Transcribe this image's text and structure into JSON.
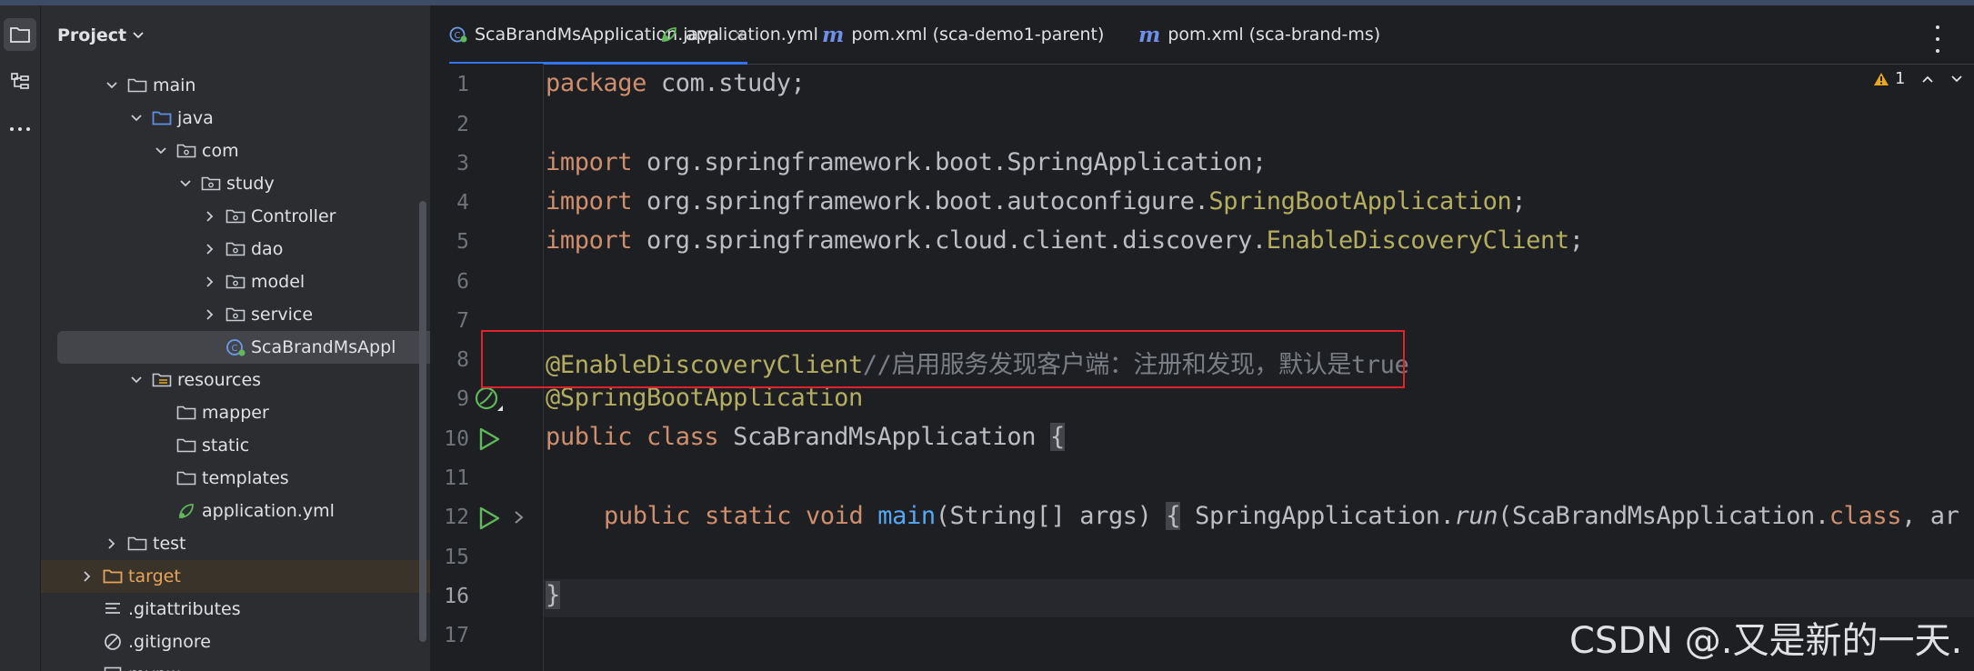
{
  "project_panel": {
    "title": "Project",
    "tree": [
      {
        "label": "main",
        "type": "folder",
        "depth": 3,
        "expanded": true
      },
      {
        "label": "java",
        "type": "source-folder",
        "depth": 4,
        "expanded": true
      },
      {
        "label": "com",
        "type": "package",
        "depth": 5,
        "expanded": true
      },
      {
        "label": "study",
        "type": "package",
        "depth": 6,
        "expanded": true
      },
      {
        "label": "Controller",
        "type": "package",
        "depth": 7,
        "expanded": false
      },
      {
        "label": "dao",
        "type": "package",
        "depth": 7,
        "expanded": false
      },
      {
        "label": "model",
        "type": "package",
        "depth": 7,
        "expanded": false
      },
      {
        "label": "service",
        "type": "package",
        "depth": 7,
        "expanded": false
      },
      {
        "label": "ScaBrandMsAppl",
        "type": "spring-class",
        "depth": 7,
        "selected": true
      },
      {
        "label": "resources",
        "type": "resources-folder",
        "depth": 4,
        "expanded": true
      },
      {
        "label": "mapper",
        "type": "folder",
        "depth": 5
      },
      {
        "label": "static",
        "type": "folder",
        "depth": 5
      },
      {
        "label": "templates",
        "type": "folder",
        "depth": 5
      },
      {
        "label": "application.yml",
        "type": "yml",
        "depth": 5
      },
      {
        "label": "test",
        "type": "folder",
        "depth": 3,
        "expanded": false
      },
      {
        "label": "target",
        "type": "excluded-folder",
        "depth": 2,
        "expanded": false
      },
      {
        "label": ".gitattributes",
        "type": "text-file",
        "depth": 2
      },
      {
        "label": ".gitignore",
        "type": "ignore-file",
        "depth": 2
      },
      {
        "label": "mvnw",
        "type": "script-file",
        "depth": 2
      }
    ]
  },
  "tabs": [
    {
      "label": "ScaBrandMsApplication.java",
      "icon": "spring-class-icon",
      "active": true,
      "close": "×"
    },
    {
      "label": "application.yml",
      "icon": "yml-icon",
      "active": false
    },
    {
      "label": "pom.xml (sca-demo1-parent)",
      "icon": "maven-icon",
      "active": false
    },
    {
      "label": "pom.xml (sca-brand-ms)",
      "icon": "maven-icon",
      "active": false
    }
  ],
  "editor": {
    "warning_count": "1",
    "line_numbers": [
      "1",
      "2",
      "3",
      "4",
      "5",
      "6",
      "7",
      "8",
      "9",
      "10",
      "11",
      "12",
      "15",
      "16",
      "17"
    ],
    "current_line": "16",
    "lines": {
      "l1_kw": "package",
      "l1_rest": " com.study;",
      "l3_kw": "import",
      "l3_rest": " org.springframework.boot.SpringApplication;",
      "l4_kw": "import",
      "l4_rest": " org.springframework.boot.autoconfigure.",
      "l4_ann": "SpringBootApplication",
      "l4_end": ";",
      "l5_kw": "import",
      "l5_rest": " org.springframework.cloud.client.discovery.",
      "l5_ann": "EnableDiscoveryClient",
      "l5_end": ";",
      "l8_ann": "@EnableDiscoveryClient",
      "l8_cmt": "//启用服务发现客户端：注册和发现，默认是true",
      "l9_ann": "@SpringBootApplication",
      "l10_kw": "public class",
      "l10_name": " ScaBrandMsApplication ",
      "l10_brace": "{",
      "l12_kw": "public static void",
      "l12_fn": "main",
      "l12_args": "(String[] args)",
      "l12_brace": "{",
      "l12_body_a": " SpringApplication.",
      "l12_run": "run",
      "l12_body_b": "(ScaBrandMsApplication.",
      "l12_class": "class",
      "l12_tail": ", ar",
      "l16_brace": "}"
    }
  },
  "watermark": "CSDN @.又是新的一天.",
  "colors": {
    "keyword": "#cf8e6d",
    "annotation": "#b3ae60",
    "function": "#56a8f5",
    "comment": "#7a7e85",
    "highlight_box": "#e0222c",
    "accent": "#3574f0"
  }
}
